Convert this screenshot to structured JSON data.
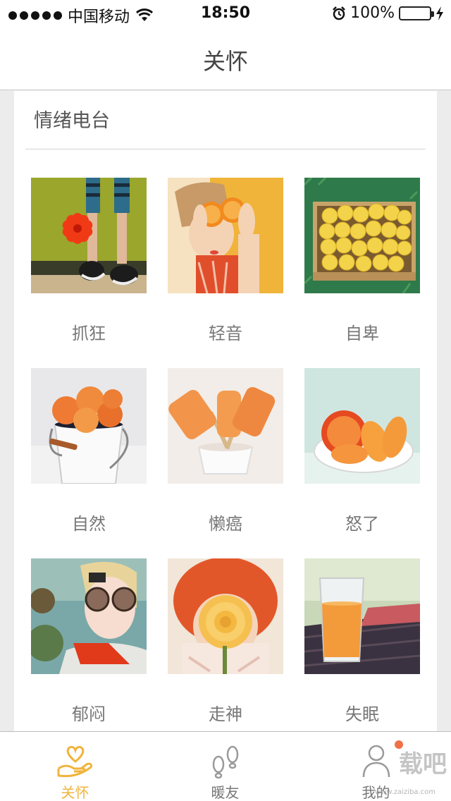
{
  "status_bar": {
    "carrier": "中国移动",
    "time": "18:50",
    "battery": "100%"
  },
  "nav": {
    "title": "关怀"
  },
  "section": {
    "title": "情绪电台"
  },
  "tiles": [
    {
      "label": "抓狂",
      "image": "legs-with-red-flower"
    },
    {
      "label": "轻音",
      "image": "girl-holding-orange-halves"
    },
    {
      "label": "自卑",
      "image": "crate-of-lemons-on-grass"
    },
    {
      "label": "自然",
      "image": "bucket-of-apricots"
    },
    {
      "label": "懒癌",
      "image": "orange-popsicles-in-cup"
    },
    {
      "label": "怒了",
      "image": "sliced-apricots-in-bowl"
    },
    {
      "label": "郁闷",
      "image": "woman-with-sunglasses"
    },
    {
      "label": "走神",
      "image": "redhead-holding-yellow-rose"
    },
    {
      "label": "失眠",
      "image": "glass-of-orange-juice"
    }
  ],
  "tabbar": {
    "tabs": [
      {
        "label": "关怀",
        "icon": "heart-hand-icon",
        "active": true
      },
      {
        "label": "暖友",
        "icon": "footprints-icon",
        "active": false
      },
      {
        "label": "我的",
        "icon": "person-icon",
        "active": false
      }
    ],
    "watermark": "载吧",
    "watermark_url": "www.zaiziba.com"
  },
  "colors": {
    "accent": "#f0b43c",
    "inactive": "#888888",
    "badge": "#f07048",
    "battery": "#4cd964"
  }
}
